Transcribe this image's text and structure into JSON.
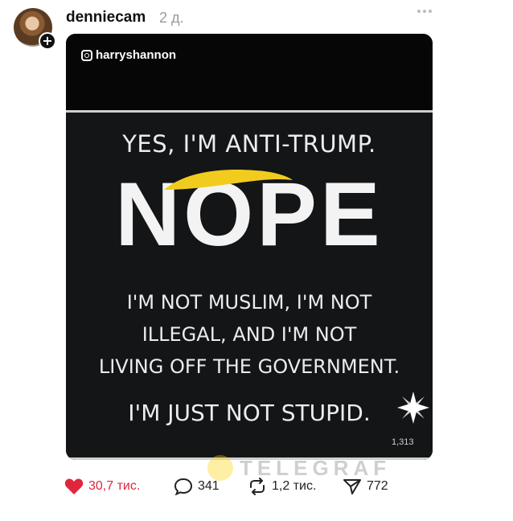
{
  "post": {
    "username": "denniecam",
    "time": "2 д.",
    "avatar_plus": "+"
  },
  "image": {
    "ig_handle": "harryshannon",
    "line1": "YES, I'M ANTI-TRUMP.",
    "big_word": "NOPE",
    "line3": "I'M NOT MUSLIM, I'M NOT",
    "line4": "ILLEGAL, AND I'M NOT",
    "line5": "LIVING OFF THE GOVERNMENT.",
    "line6": "I'M JUST NOT STUPID.",
    "counter": "1,313"
  },
  "watermark": {
    "text": "TELEGRAF"
  },
  "actions": {
    "likes": "30,7 тис.",
    "comments": "341",
    "reposts": "1,2 тис.",
    "shares": "772"
  },
  "icons": {
    "like": "heart-icon",
    "comment": "comment-bubble-icon",
    "repost": "repost-arrows-icon",
    "share": "send-icon",
    "more": "ellipsis-icon"
  },
  "colors": {
    "like": "#e0263b",
    "swoosh": "#f1cc1e",
    "meme_bg": "#131516"
  }
}
